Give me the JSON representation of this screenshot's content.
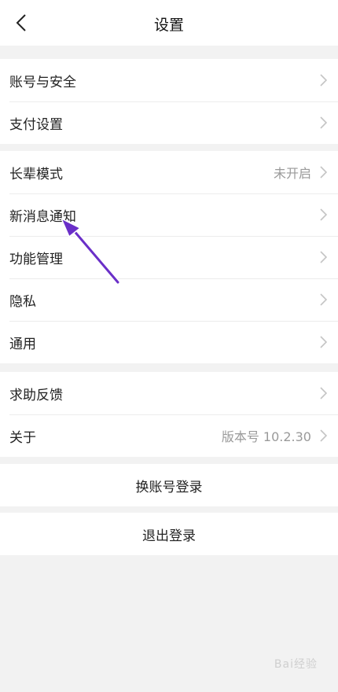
{
  "header": {
    "title": "设置",
    "back_icon": "chevron-left-icon"
  },
  "groups": [
    {
      "items": [
        {
          "label": "账号与安全",
          "value": ""
        },
        {
          "label": "支付设置",
          "value": ""
        }
      ]
    },
    {
      "items": [
        {
          "label": "长辈模式",
          "value": "未开启"
        },
        {
          "label": "新消息通知",
          "value": ""
        },
        {
          "label": "功能管理",
          "value": ""
        },
        {
          "label": "隐私",
          "value": ""
        },
        {
          "label": "通用",
          "value": ""
        }
      ]
    },
    {
      "items": [
        {
          "label": "求助反馈",
          "value": ""
        },
        {
          "label": "关于",
          "value": "版本号 10.2.30"
        }
      ]
    }
  ],
  "actions": {
    "switch_account": "换账号登录",
    "logout": "退出登录"
  },
  "annotation": {
    "arrow_color": "#6a2fc8",
    "icon": "arrow-icon"
  },
  "watermark": {
    "text": "Bai经验"
  },
  "colors": {
    "background": "#f2f2f2",
    "row_bg": "#ffffff",
    "value_text": "#9a9a9a"
  }
}
